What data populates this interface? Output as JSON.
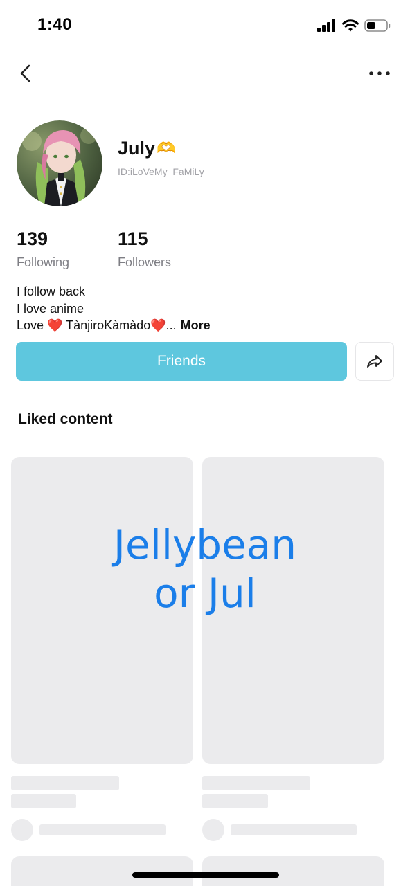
{
  "status_bar": {
    "time": "1:40",
    "signal_icon": "cellular-signal-icon",
    "wifi_icon": "wifi-icon",
    "battery_icon": "battery-icon"
  },
  "nav": {
    "back_icon": "chevron-left-icon",
    "more_icon": "more-horizontal-icon"
  },
  "profile": {
    "name": "July",
    "name_emoji": "🫶",
    "id": "ID:iLoVeMy_FaMiLy",
    "following_count": "139",
    "following_label": "Following",
    "followers_count": "115",
    "followers_label": "Followers",
    "bio": {
      "line1": "I follow back",
      "line2": "I love anime",
      "line3_prefix": "Love ",
      "line3_heart": "❤️",
      "line3_middle": " TànjiroKàmàdo",
      "line3_heart2": "❤️",
      "line3_ellipsis": "...",
      "more_label": "More"
    }
  },
  "actions": {
    "friends_label": "Friends",
    "share_icon": "share-arrow-icon"
  },
  "liked": {
    "title": "Liked content"
  },
  "overlay": {
    "line1": "Jellybean",
    "line2": "or Jul"
  },
  "colors": {
    "friends_button": "#5ec7de",
    "overlay_text": "#1b7ee9",
    "skeleton": "#ebebed",
    "muted_text": "#7e7e84"
  }
}
